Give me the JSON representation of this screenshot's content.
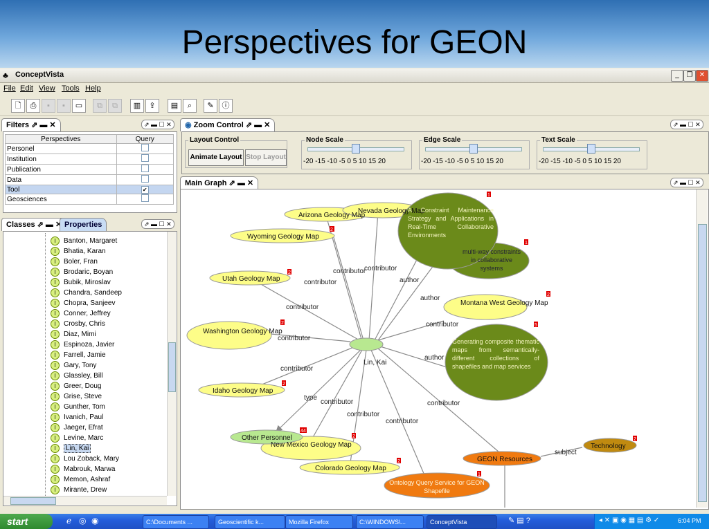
{
  "slide": {
    "title": "Perspectives for GEON"
  },
  "window": {
    "title": "ConceptVista"
  },
  "menu": [
    "File",
    "Edit",
    "View",
    "Tools",
    "Help"
  ],
  "filters": {
    "tab": "Filters",
    "headers": [
      "Perspectives",
      "Query"
    ],
    "rows": [
      {
        "name": "Personel",
        "checked": ""
      },
      {
        "name": "Institution",
        "checked": ""
      },
      {
        "name": "Publication",
        "checked": ""
      },
      {
        "name": "Data",
        "checked": ""
      },
      {
        "name": "Tool",
        "checked": "✔"
      },
      {
        "name": "Geosciences",
        "checked": ""
      }
    ]
  },
  "classes": {
    "tab_classes": "Classes",
    "tab_properties": "Properties",
    "items": [
      "Banton, Margaret",
      "Bhatia, Karan",
      "Boler, Fran",
      "Brodaric, Boyan",
      "Bubik, Miroslav",
      "Chandra, Sandeep",
      "Chopra, Sanjeev",
      "Conner, Jeffrey",
      "Crosby, Chris",
      "Diaz, Mimi",
      "Espinoza, Javier",
      "Farrell, Jamie",
      "Gary, Tony",
      "Glassley, Bill",
      "Greer, Doug",
      "Grise, Steve",
      "Gunther, Tom",
      "Ivanich, Paul",
      "Jaeger, Efrat",
      "Levine, Marc",
      "Lin, Kai",
      "Lou Zoback, Mary",
      "Mabrouk, Marwa",
      "Memon, Ashraf",
      "Mirante, Drew"
    ],
    "selected": "Lin, Kai"
  },
  "zoom": {
    "tab": "Zoom Control",
    "layout_label": "Layout Control",
    "animate": "Animate Layout",
    "stop": "Stop Layout",
    "node_scale": "Node Scale",
    "edge_scale": "Edge Scale",
    "text_scale": "Text Scale",
    "ticks": "-20 -15 -10  -5   0   5  10  15  20",
    "node_value": 0,
    "edge_value": 0,
    "text_value": 0
  },
  "graph": {
    "tab": "Main Graph",
    "center": "Lin, Kai",
    "nodes": {
      "arizona": "Arizona Geology Map",
      "nevada": "Nevada Geology Map",
      "wyoming": "Wyoming Geology Map",
      "utah": "Utah Geology Map",
      "washington": "Washington Geology Map",
      "idaho": "Idaho Geology Map",
      "montana": "Montana West Geology Map",
      "newmexico": "New Mexico Geology Map",
      "colorado": "Colorado Geology Map",
      "other": "Other Personnel",
      "geonres": "GEON Resources",
      "technology": "Technology",
      "ontology": "Ontology Query Service for GEON Shapefile",
      "constraint": "A Constraint Maintenance Strategy and Applications in Real-Time Collaborative Environments",
      "multiway": "multi-way constraints in collaborative systems",
      "generating": "Generating composite thematic maps from semantically-different collections of shapefiles and map services"
    },
    "edge_labels": [
      "contributor",
      "contributor",
      "contributor",
      "author",
      "author",
      "contributor",
      "contributor",
      "contributor",
      "author",
      "contributor",
      "type",
      "contributor",
      "contributor",
      "contributor",
      "contributor",
      "subject"
    ],
    "badges": {
      "b1": "1",
      "b2": "2",
      "b3": "2",
      "b4": "1",
      "b5": "2",
      "b6": "2",
      "b7": "5",
      "b8": "2",
      "b9": "44",
      "b10": "2",
      "b11": "2",
      "b12": "2",
      "b13": "1"
    }
  },
  "taskbar": {
    "start": "start",
    "tasks": [
      "C:\\Documents ...",
      "Geoscientific k...",
      "Mozilla Firefox",
      "C:\\WINDOWS\\...",
      "ConceptVista"
    ],
    "clock": "6:04 PM"
  },
  "colors": {
    "yellow_node": "#fdfd88",
    "green_node": "#6b8a1a",
    "orange_node": "#f07a10",
    "light_green": "#b8e890",
    "badge": "#e00000"
  }
}
